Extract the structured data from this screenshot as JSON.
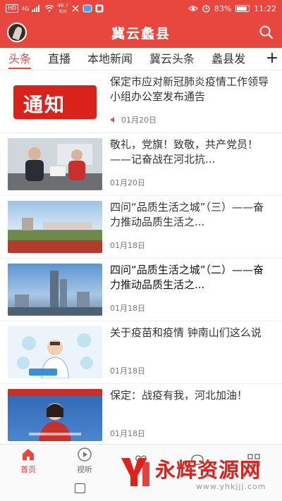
{
  "status_bar": {
    "network_left": "HD",
    "signal_label": "4G",
    "speed_value": "46.7",
    "speed_unit": "K/s",
    "battery": "83%",
    "time": "11:22"
  },
  "header": {
    "title": "冀云蠡县"
  },
  "tabs": [
    "头条",
    "直播",
    "本地新闻",
    "冀云头条",
    "蠡县发"
  ],
  "tab_add_label": "+",
  "feed": [
    {
      "title": "保定市应对新冠肺炎疫情工作领导小组办公室发布通告",
      "date": "01月20日",
      "thumb_text": "通知",
      "has_audio": true
    },
    {
      "title": "敬礼，党旗！致敬，共产党员！——记奋战在河北抗...",
      "date": "01月20日"
    },
    {
      "title": "四问“品质生活之城”（三）——奋力推动品质生活之...",
      "date": "01月18日"
    },
    {
      "title": "四问“品质生活之城”（二）——奋力推动品质生活之...",
      "date": "01月18日"
    },
    {
      "title": "关于疫苗和疫情 钟南山们这么说",
      "date": "01月18日"
    },
    {
      "title": "保定：战疫有我，河北加油！",
      "date": "01月18日"
    }
  ],
  "bottom_nav": [
    "首页",
    "视听",
    "",
    "",
    ""
  ],
  "watermark": {
    "text": "永辉资源网",
    "url": "www.yhkjjj.com"
  },
  "colors": {
    "brand_red": "#e8473e",
    "watermark_red": "#e0201a"
  }
}
